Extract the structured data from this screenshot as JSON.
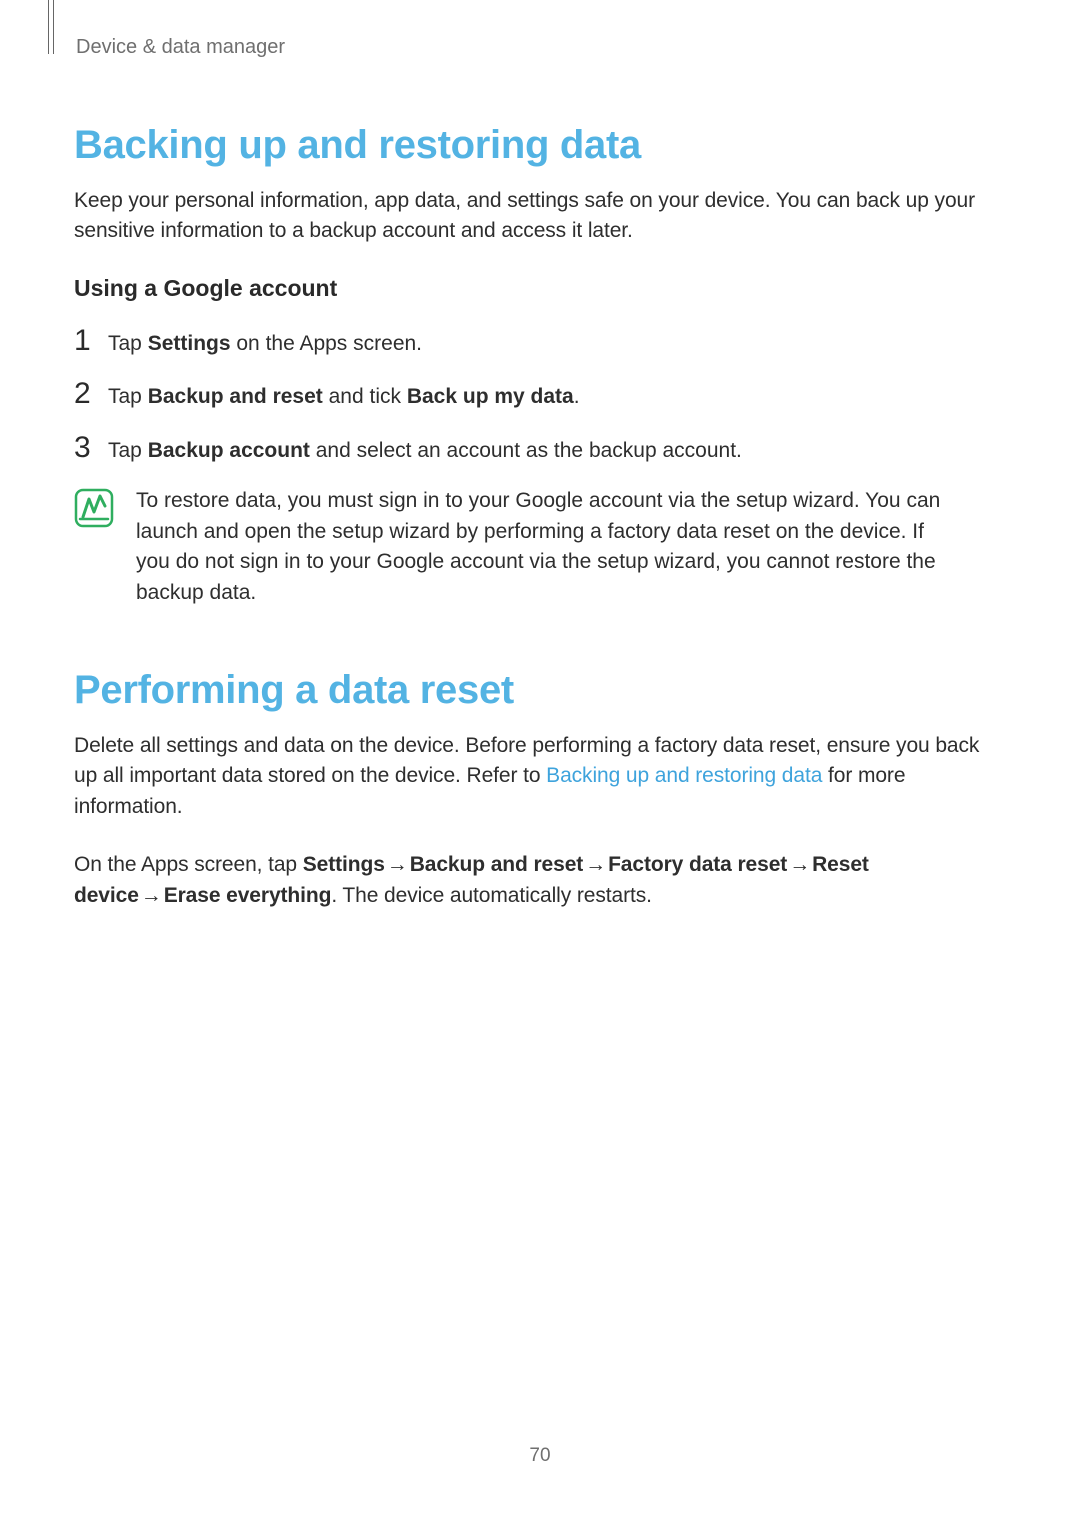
{
  "breadcrumb": "Device & data manager",
  "section1": {
    "title": "Backing up and restoring data",
    "intro": "Keep your personal information, app data, and settings safe on your device. You can back up your sensitive information to a backup account and access it later.",
    "subheading": "Using a Google account",
    "steps": {
      "s1": {
        "num": "1",
        "pre": "Tap ",
        "b1": "Settings",
        "post": " on the Apps screen."
      },
      "s2": {
        "num": "2",
        "pre": "Tap ",
        "b1": "Backup and reset",
        "mid": " and tick ",
        "b2": "Back up my data",
        "post": "."
      },
      "s3": {
        "num": "3",
        "pre": "Tap ",
        "b1": "Backup account",
        "post": " and select an account as the backup account."
      }
    },
    "note": "To restore data, you must sign in to your Google account via the setup wizard. You can launch and open the setup wizard by performing a factory data reset on the device. If you do not sign in to your Google account via the setup wizard, you cannot restore the backup data."
  },
  "section2": {
    "title": "Performing a data reset",
    "p1_a": "Delete all settings and data on the device. Before performing a factory data reset, ensure you back up all important data stored on the device. Refer to ",
    "p1_link": "Backing up and restoring data",
    "p1_b": " for more information.",
    "p2_a": "On the Apps screen, tap ",
    "p2_b1": "Settings",
    "p2_b2": "Backup and reset",
    "p2_b3": "Factory data reset",
    "p2_b4": "Reset device",
    "p2_b5": "Erase everything",
    "p2_end": ". The device automatically restarts.",
    "arrow": "→"
  },
  "page_number": "70"
}
